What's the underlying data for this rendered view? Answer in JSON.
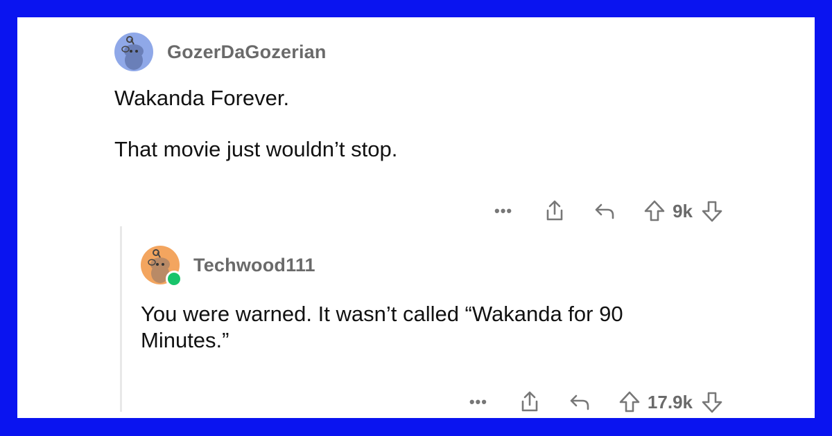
{
  "comments": [
    {
      "username": "GozerDaGozerian",
      "avatar_color": "#8fa8e8",
      "paragraphs": [
        "Wakanda Forever.",
        "That movie just wouldn’t stop."
      ],
      "more_icon": "more-dots-icon",
      "share_icon": "share-icon",
      "reply_icon": "reply-icon",
      "upvote_icon": "upvote-icon",
      "vote_count": "9k",
      "downvote_icon": "downvote-icon"
    },
    {
      "username": "Techwood111",
      "avatar_color": "#f3a55f",
      "online": true,
      "online_color": "#18c46b",
      "text": "You were warned.  It wasn’t called “Wakanda for 90 Minutes.”",
      "vote_count": "17.9k"
    }
  ],
  "more_label": "•••"
}
